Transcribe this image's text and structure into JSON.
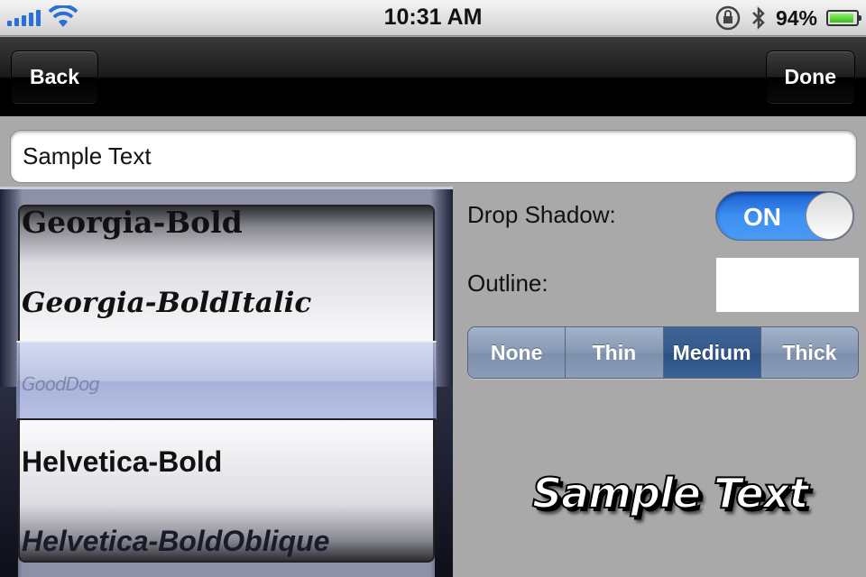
{
  "status_bar": {
    "time": "10:31 AM",
    "battery_percent_label": "94%",
    "battery_level": 0.94,
    "icons": [
      "signal-bars-icon",
      "wifi-icon",
      "rotation-lock-icon",
      "bluetooth-icon",
      "battery-icon"
    ]
  },
  "nav_bar": {
    "back_label": "Back",
    "done_label": "Done"
  },
  "text_field": {
    "value": "Sample Text"
  },
  "font_picker": {
    "items": [
      "Georgia-Bold",
      "Georgia-BoldItalic",
      "GoodDog",
      "Helvetica-Bold",
      "Helvetica-BoldOblique"
    ],
    "selected": "GoodDog"
  },
  "options": {
    "drop_shadow_label": "Drop Shadow:",
    "drop_shadow_state": "ON",
    "outline_label": "Outline:",
    "outline_color": "#ffffff",
    "thickness_options": [
      "None",
      "Thin",
      "Medium",
      "Thick"
    ],
    "thickness_selected": "Medium"
  },
  "preview": {
    "text": "Sample Text"
  },
  "colors": {
    "toggle_on": "#3d8ff0",
    "segment_selected": "#34598c",
    "segment_normal": "#8698b4",
    "background": "#a9a9a9"
  }
}
